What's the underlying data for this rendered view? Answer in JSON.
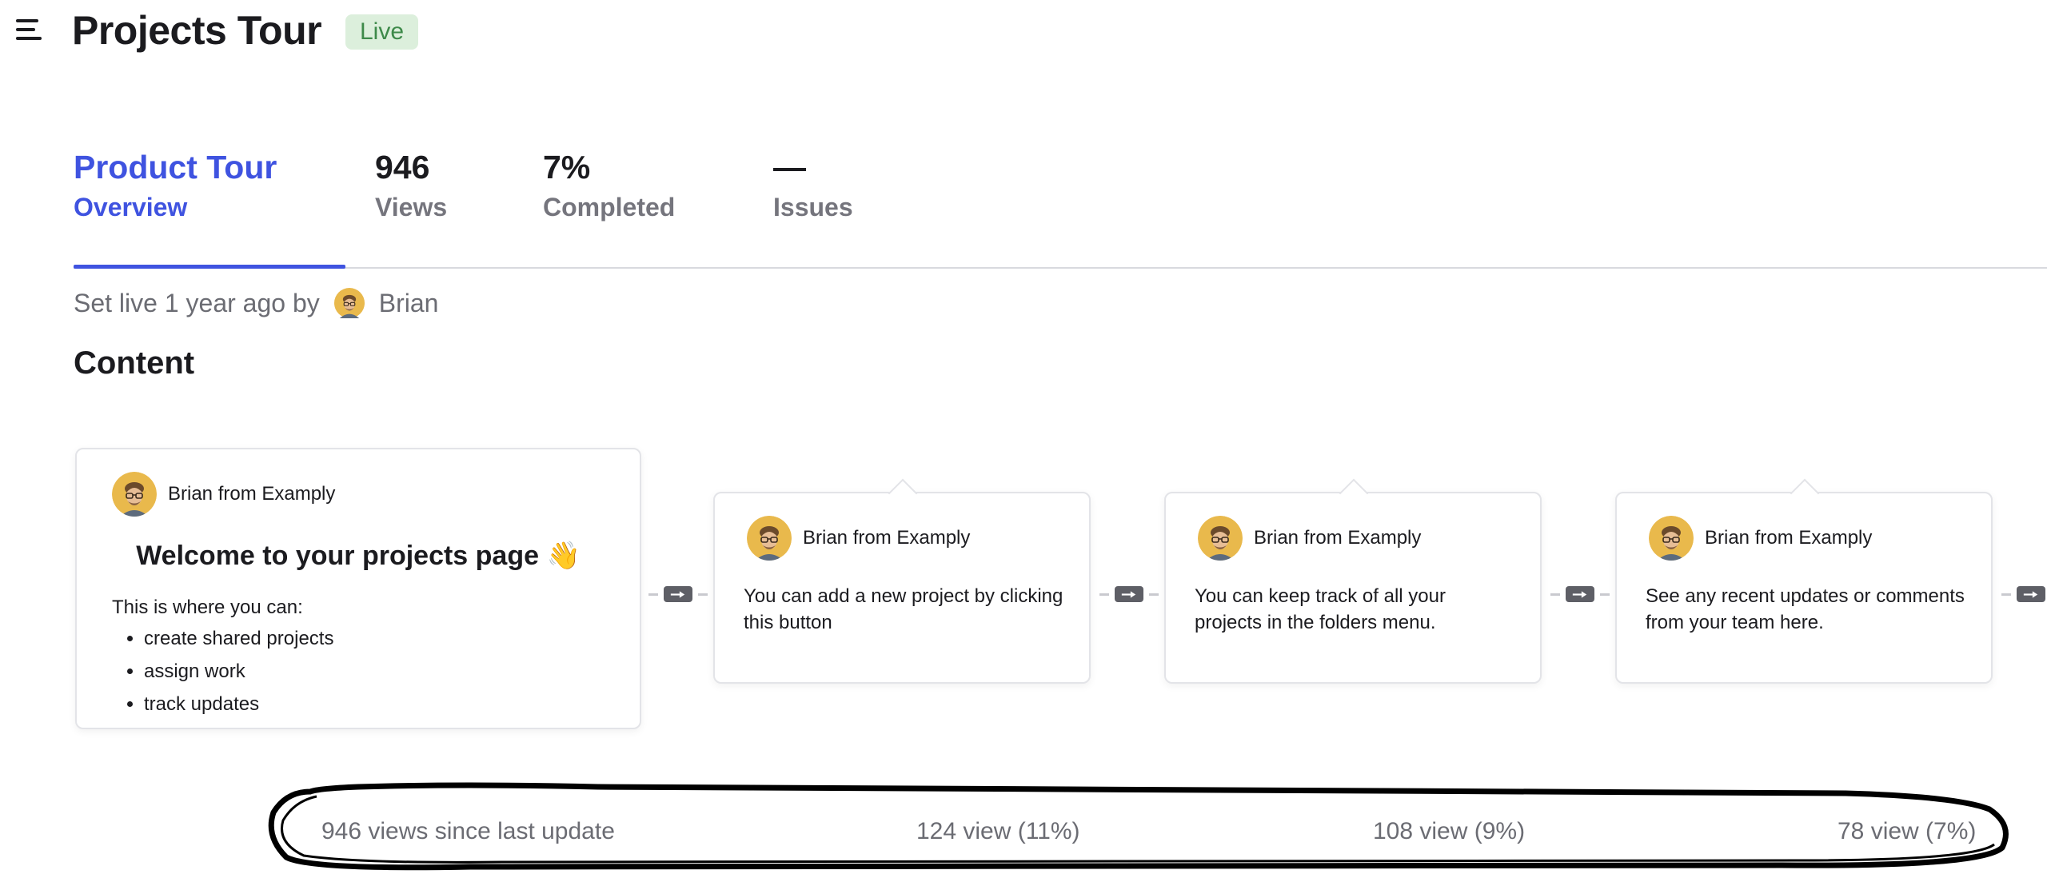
{
  "header": {
    "title": "Projects Tour",
    "status_badge": "Live"
  },
  "tabs": [
    {
      "value": "Product Tour",
      "label": "Overview",
      "active": true
    },
    {
      "value": "946",
      "label": "Views"
    },
    {
      "value": "7%",
      "label": "Completed"
    },
    {
      "value": "—",
      "label": "Issues"
    }
  ],
  "meta": {
    "set_live_text": "Set live 1 year ago by",
    "author": "Brian"
  },
  "content": {
    "section_title": "Content",
    "intro_card": {
      "author": "Brian from Examply",
      "heading": "Welcome to your projects page 👋",
      "intro": "This is where you can:",
      "bullets": [
        "create shared projects",
        "assign work",
        "track updates"
      ]
    },
    "steps": [
      {
        "author": "Brian from Examply",
        "message": "You can add a new project by clicking this button"
      },
      {
        "author": "Brian from Examply",
        "message": "You can keep track of all your projects in the folders menu."
      },
      {
        "author": "Brian from Examply",
        "message": "See any recent updates or comments from your team here."
      }
    ]
  },
  "stats": {
    "total": "946 views since last update",
    "steps": [
      "124 view (11%)",
      "108 view (9%)",
      "78 view (7%)"
    ]
  },
  "icons": {
    "menu": "hamburger-menu-icon",
    "avatar": "user-avatar",
    "connector": "arrow-right-icon"
  },
  "colors": {
    "accent": "#3f53e0",
    "badge_bg": "#dcefdc",
    "badge_text": "#3e8a4a",
    "muted_text": "#6b6c73",
    "avatar_bg": "#e9b94c"
  }
}
